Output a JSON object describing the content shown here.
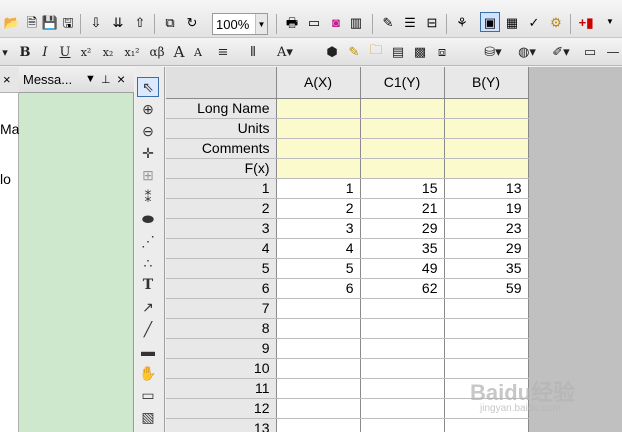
{
  "toolbar": {
    "zoom_value": "100%",
    "icons_row1": [
      "open-icon",
      "save-template-icon",
      "save-icon",
      "save-project-icon",
      "import-icon",
      "import-multiple-icon",
      "export-icon",
      "duplicate-icon",
      "refresh-icon",
      "print-icon",
      "slide-show-icon",
      "layer-icon",
      "column-icon",
      "code-builder-icon",
      "results-log-icon",
      "command-window-icon",
      "project-explorer-icon",
      "data-display-icon",
      "ascii-icon",
      "notes-icon",
      "gear-icon",
      "add-column-icon"
    ],
    "format_buttons": [
      "B",
      "I",
      "U",
      "x²",
      "x₂",
      "x₁²",
      "αβ",
      "A",
      "A"
    ]
  },
  "left_panel": {
    "fragments": [
      "Ma",
      "lo"
    ]
  },
  "messages_panel": {
    "title": "Messa...",
    "pin_glyph": "⊥",
    "close_glyph": "×",
    "menu_glyph": "▼"
  },
  "tools": [
    "pointer",
    "zoom-in",
    "zoom-out",
    "data-reader",
    "region",
    "screen-reader",
    "mask",
    "draw-data",
    "scale",
    "text",
    "arrow",
    "line",
    "rectangle",
    "pan",
    "region2",
    "zoom-panel"
  ],
  "worksheet": {
    "columns": [
      "A(X)",
      "C1(Y)",
      "B(Y)"
    ],
    "label_rows": [
      "Long Name",
      "Units",
      "Comments",
      "F(x)"
    ],
    "rows": [
      {
        "num": "1",
        "cells": [
          "1",
          "15",
          "13"
        ]
      },
      {
        "num": "2",
        "cells": [
          "2",
          "21",
          "19"
        ]
      },
      {
        "num": "3",
        "cells": [
          "3",
          "29",
          "23"
        ]
      },
      {
        "num": "4",
        "cells": [
          "4",
          "35",
          "29"
        ]
      },
      {
        "num": "5",
        "cells": [
          "5",
          "49",
          "35"
        ]
      },
      {
        "num": "6",
        "cells": [
          "6",
          "62",
          "59"
        ]
      },
      {
        "num": "7",
        "cells": [
          "",
          "",
          ""
        ]
      },
      {
        "num": "8",
        "cells": [
          "",
          "",
          ""
        ]
      },
      {
        "num": "9",
        "cells": [
          "",
          "",
          ""
        ]
      },
      {
        "num": "10",
        "cells": [
          "",
          "",
          ""
        ]
      },
      {
        "num": "11",
        "cells": [
          "",
          "",
          ""
        ]
      },
      {
        "num": "12",
        "cells": [
          "",
          "",
          ""
        ]
      },
      {
        "num": "13",
        "cells": [
          "",
          "",
          ""
        ]
      }
    ]
  },
  "watermark": {
    "text": "Baidu经验",
    "sub": "jingyan.baidu.com"
  }
}
